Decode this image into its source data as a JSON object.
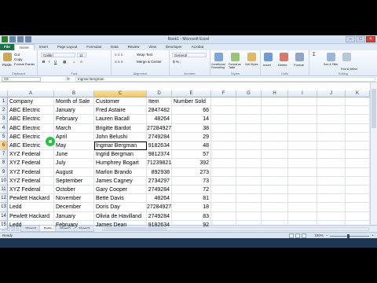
{
  "window": {
    "title": "Book1 - Microsoft Excel"
  },
  "ribbon": {
    "file_tab": "File",
    "tabs": [
      "Home",
      "Insert",
      "Page Layout",
      "Formulas",
      "Data",
      "Review",
      "View",
      "Developer",
      "Acrobat"
    ],
    "clipboard": {
      "paste": "Paste",
      "cut": "Cut",
      "copy": "Copy",
      "format_painter": "Format Painter",
      "label": "Clipboard"
    },
    "font": {
      "name": "Calibri",
      "size": "11",
      "label": "Font"
    },
    "alignment": {
      "wrap": "Wrap Text",
      "merge": "Merge & Center",
      "label": "Alignment"
    },
    "number": {
      "format": "General",
      "label": "Number"
    },
    "styles": {
      "conditional": "Conditional Formatting",
      "table": "Format as Table",
      "cell_styles": "Cell Styles",
      "label": "Styles"
    },
    "cells": {
      "insert": "Insert",
      "delete": "Delete",
      "format": "Format",
      "label": "Cells"
    },
    "editing": {
      "sort": "Sort & Filter",
      "find": "Find & Select",
      "label": "Editing"
    }
  },
  "formula_bar": {
    "name_box": "C6",
    "fx": "fx",
    "content": "Ingmar Bergman"
  },
  "columns": [
    "A",
    "B",
    "C",
    "D",
    "E",
    "F",
    "G",
    "H",
    "I",
    "J",
    "K"
  ],
  "rows": [
    [
      "Company",
      "Month of Sale",
      "Customer",
      "Item",
      "Number Sold"
    ],
    [
      "ABC Electric",
      "January",
      "Fred Astaire",
      "2847482",
      "66"
    ],
    [
      "ABC Electric",
      "February",
      "Lauren Bacall",
      "48264",
      "14"
    ],
    [
      "ABC Electric",
      "March",
      "Brigitte Bardot",
      "27284927",
      "38"
    ],
    [
      "ABC Electric",
      "April",
      "John Belushi",
      "2749284",
      "29"
    ],
    [
      "ABC Electric",
      "May",
      "Ingmar Bergman",
      "9182634",
      "48"
    ],
    [
      "XYZ Federal",
      "June",
      "Ingrid Bergman",
      "9812374",
      "57"
    ],
    [
      "XYZ Federal",
      "July",
      "Humphrey Bogart",
      "71239821",
      "392"
    ],
    [
      "XYZ Federal",
      "August",
      "Marlon Brando",
      "892938",
      "273"
    ],
    [
      "XYZ Federal",
      "September",
      "James Cagney",
      "2734297",
      "73"
    ],
    [
      "XYZ Federal",
      "October",
      "Gary Cooper",
      "2749284",
      "72"
    ],
    [
      "Pewlett Hackard",
      "November",
      "Bette Davis",
      "48264",
      "81"
    ],
    [
      "Ledd",
      "December",
      "Doris Day",
      "27284927",
      "18"
    ],
    [
      "Pewlett Hackard",
      "January",
      "Olivia de Havilland",
      "2749284",
      "83"
    ],
    [
      "Ledd",
      "February",
      "James Dean",
      "9182634",
      "92"
    ]
  ],
  "row_numbers": [
    "1",
    "2",
    "3",
    "4",
    "5",
    "6",
    "7",
    "8",
    "9",
    "10",
    "11",
    "12",
    "13",
    "14",
    "15"
  ],
  "sheets": [
    "Sheet4",
    "Data",
    "Sheet1",
    "Sheet3"
  ],
  "status": {
    "ready": "Ready",
    "zoom": "100%"
  },
  "colors": {
    "file_tab": "#1e7145",
    "selection_header": "#f2c56a",
    "cursor": "#1fbf3a"
  }
}
